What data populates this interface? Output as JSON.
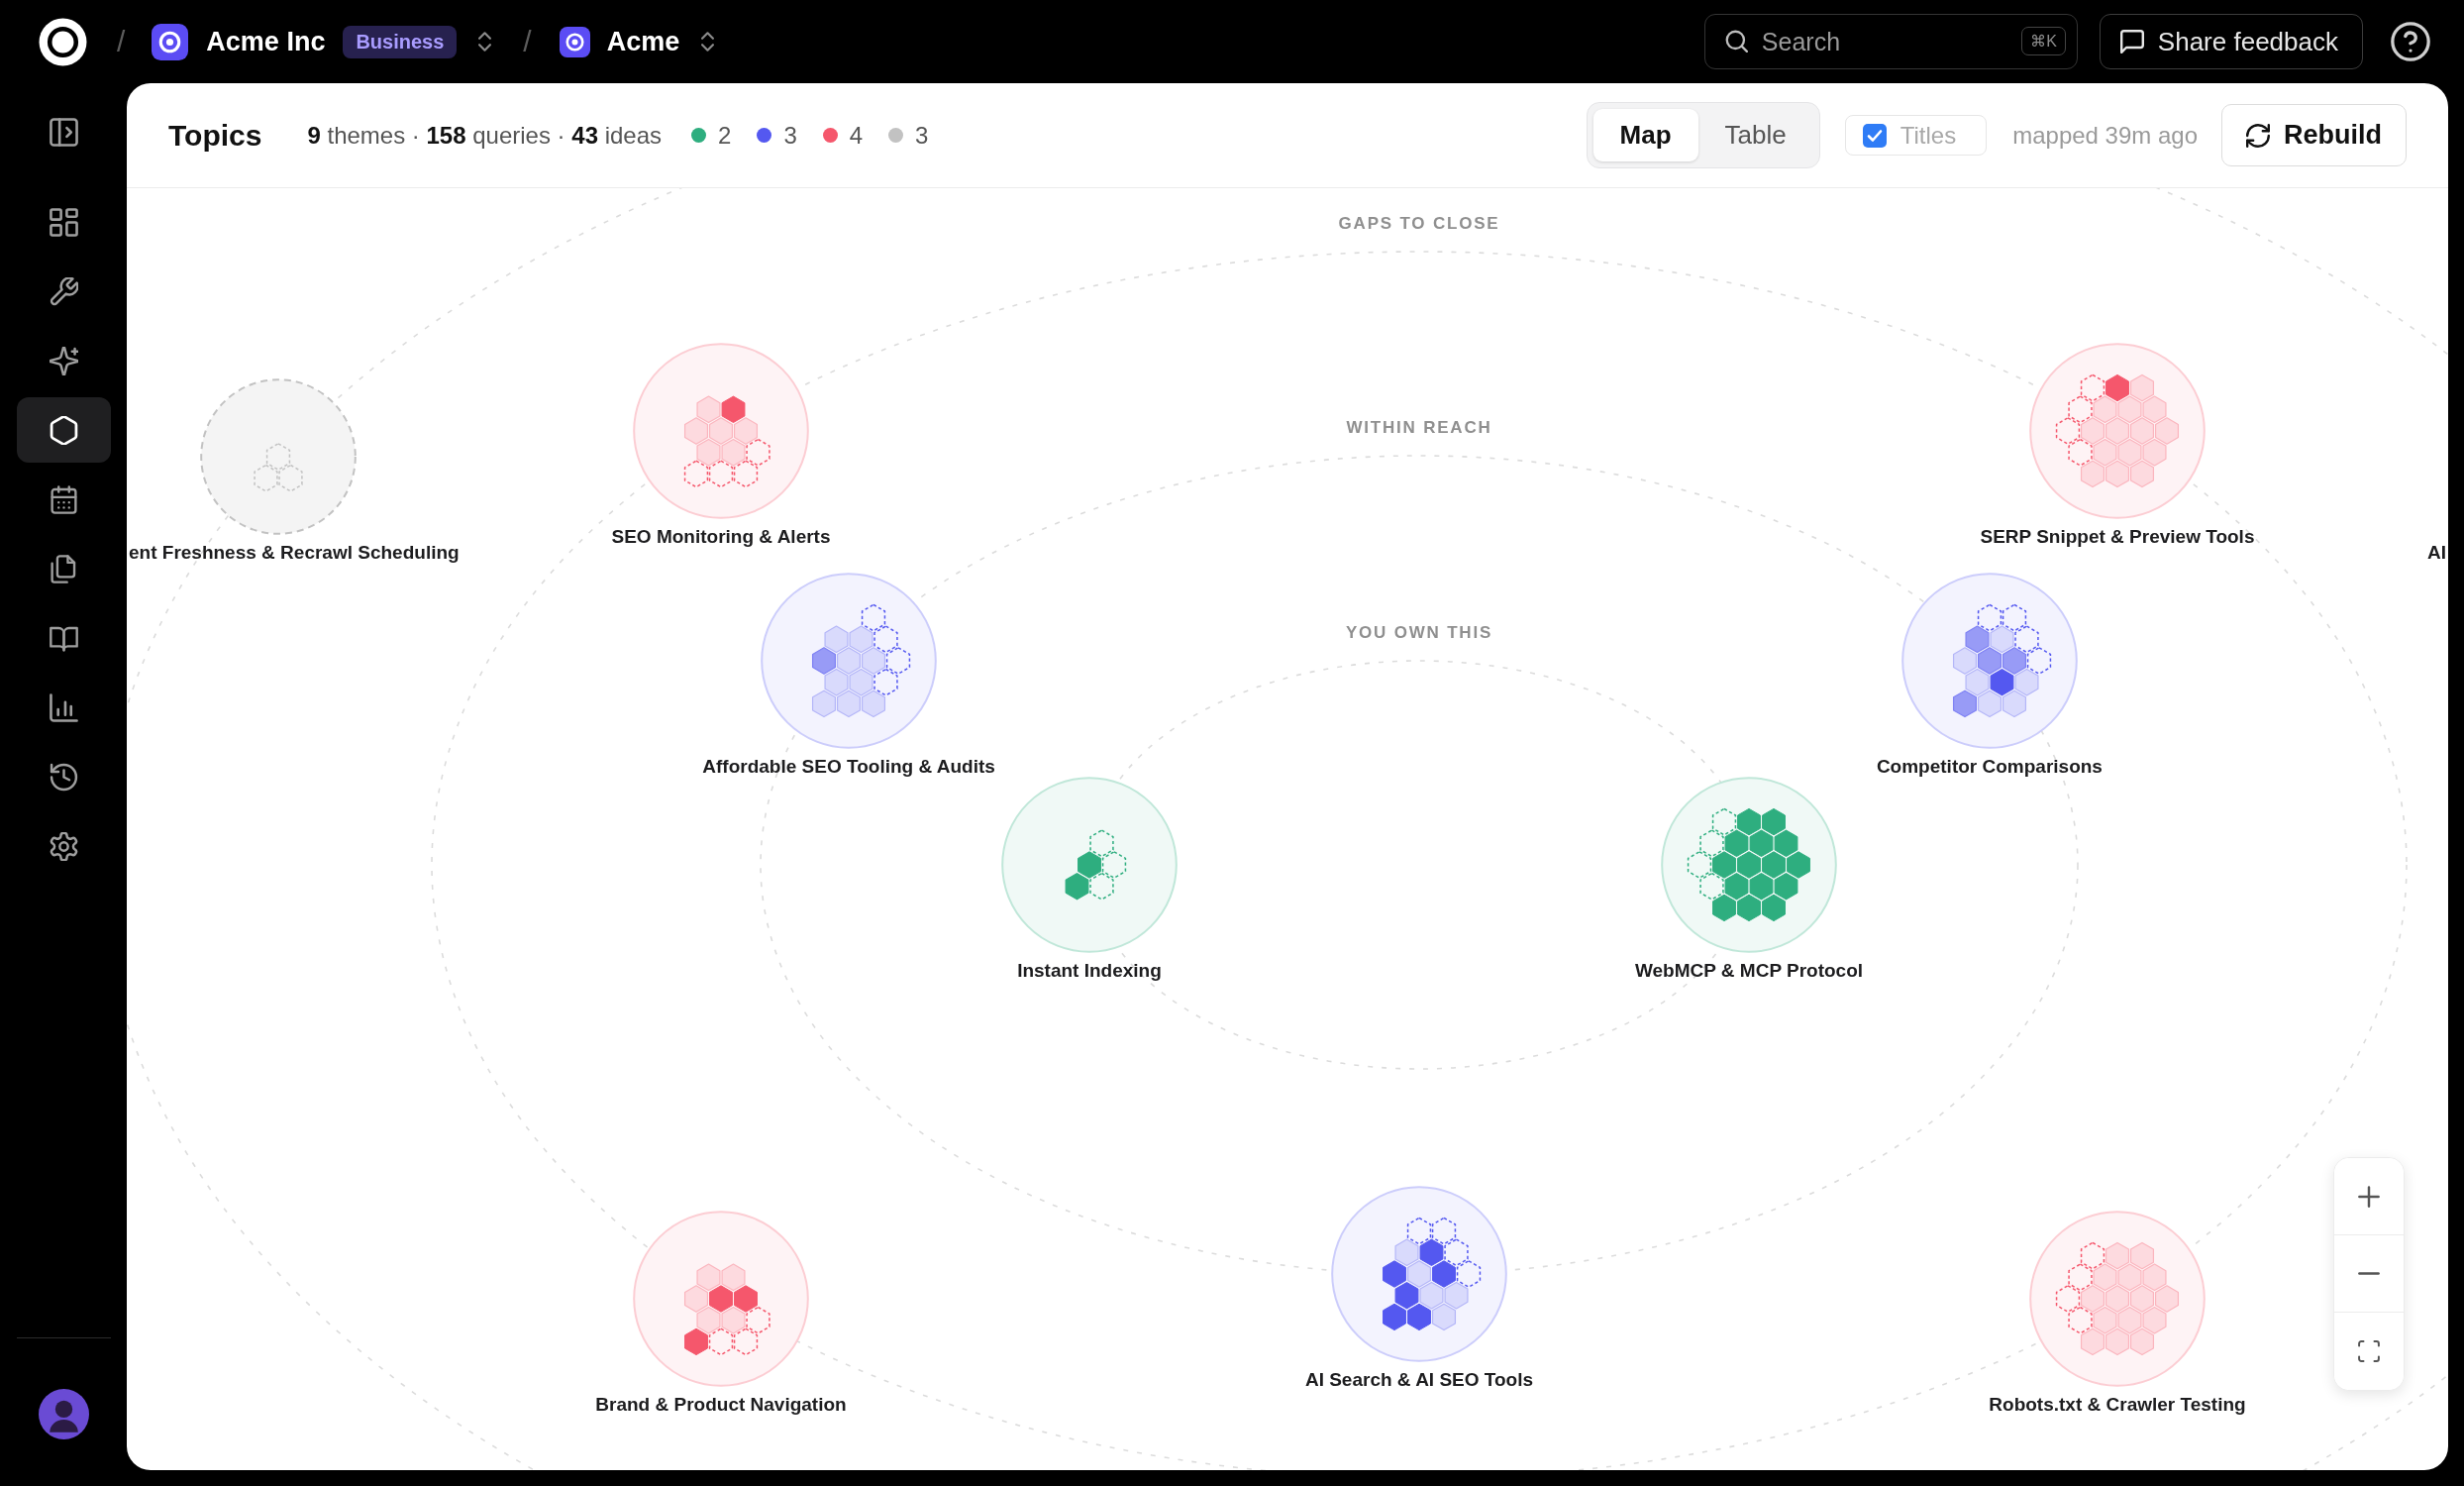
{
  "top_bar": {
    "separators": [
      "/",
      "/"
    ],
    "organization": {
      "name": "Acme Inc",
      "badge": "Business"
    },
    "project": {
      "name": "Acme"
    },
    "search": {
      "placeholder": "Search",
      "shortcut": "⌘K"
    },
    "feedback_button": {
      "label": "Share feedback"
    }
  },
  "sidebar": {
    "items": [
      {
        "kind": "dashboard",
        "selected": false
      },
      {
        "kind": "tools",
        "selected": false
      },
      {
        "kind": "sparkles",
        "selected": false
      },
      {
        "kind": "topics",
        "selected": true
      },
      {
        "kind": "calendar",
        "selected": false
      },
      {
        "kind": "pages",
        "selected": false
      },
      {
        "kind": "book",
        "selected": false
      },
      {
        "kind": "chart",
        "selected": false
      },
      {
        "kind": "history",
        "selected": false
      },
      {
        "kind": "settings",
        "selected": false
      }
    ]
  },
  "header": {
    "title": "Topics",
    "summary": "**9** themes · **158** queries · **43** ideas",
    "legend": [
      {
        "color": "#2eae7f",
        "count": "2"
      },
      {
        "color": "#5458f0",
        "count": "3"
      },
      {
        "color": "#f5576c",
        "count": "4"
      },
      {
        "color": "#c2c2c2",
        "count": "3"
      }
    ],
    "views": [
      {
        "label": "Map",
        "selected": true
      },
      {
        "label": "Table",
        "selected": false
      }
    ],
    "titles_toggle": {
      "label": "Titles",
      "checked": true
    },
    "status": "mapped 39m ago",
    "rebuild_button": {
      "label": "Rebuild"
    }
  },
  "map": {
    "rings": [
      {
        "label": "GAPS TO CLOSE",
        "color": "#f5576c",
        "nodes": [
          {
            "label": "SEO Monitoring & Alerts",
            "cells": [
              [
                null,
                null,
                null
              ],
              [
                null,
                {
                  "kind": "weak"
                },
                {
                  "kind": "strong"
                },
                null
              ],
              [
                null,
                {
                  "kind": "weak"
                },
                {
                  "kind": "weak"
                },
                {
                  "kind": "weak"
                },
                null
              ],
              [
                null,
                {
                  "kind": "weak"
                },
                {
                  "kind": "weak"
                },
                {
                  "kind": "gap"
                }
              ],
              [
                {
                  "kind": "gap"
                },
                {
                  "kind": "gap"
                },
                {
                  "kind": "gap"
                }
              ]
            ]
          },
          {
            "label": "SERP Snippet & Preview Tools",
            "cells": [
              [
                {
                  "kind": "gap"
                },
                {
                  "kind": "strong"
                },
                {
                  "kind": "weak"
                }
              ],
              [
                {
                  "kind": "gap"
                },
                {
                  "kind": "weak"
                },
                {
                  "kind": "weak"
                },
                {
                  "kind": "weak"
                }
              ],
              [
                {
                  "kind": "gap"
                },
                {
                  "kind": "weak"
                },
                {
                  "kind": "weak"
                },
                {
                  "kind": "weak"
                },
                {
                  "kind": "weak"
                }
              ],
              [
                {
                  "kind": "gap"
                },
                {
                  "kind": "weak"
                },
                {
                  "kind": "weak"
                },
                {
                  "kind": "weak"
                }
              ],
              [
                {
                  "kind": "weak"
                },
                {
                  "kind": "weak"
                },
                {
                  "kind": "weak"
                }
              ]
            ]
          },
          {
            "label": "Brand & Product Navigation",
            "cells": [
              [
                null,
                null,
                null
              ],
              [
                null,
                {
                  "kind": "weak"
                },
                {
                  "kind": "weak"
                },
                null
              ],
              [
                null,
                {
                  "kind": "weak"
                },
                {
                  "kind": "strong"
                },
                {
                  "kind": "strong"
                },
                null
              ],
              [
                null,
                {
                  "kind": "weak"
                },
                {
                  "kind": "weak"
                },
                {
                  "kind": "gap"
                }
              ],
              [
                {
                  "kind": "strong"
                },
                {
                  "kind": "gap"
                },
                {
                  "kind": "gap"
                }
              ]
            ]
          },
          {
            "label": "Robots.txt & Crawler Testing",
            "cells": [
              [
                {
                  "kind": "gap"
                },
                {
                  "kind": "weak"
                },
                {
                  "kind": "weak"
                }
              ],
              [
                {
                  "kind": "gap"
                },
                {
                  "kind": "weak"
                },
                {
                  "kind": "weak"
                },
                {
                  "kind": "weak"
                }
              ],
              [
                {
                  "kind": "gap"
                },
                {
                  "kind": "weak"
                },
                {
                  "kind": "weak"
                },
                {
                  "kind": "weak"
                },
                {
                  "kind": "weak"
                }
              ],
              [
                {
                  "kind": "gap"
                },
                {
                  "kind": "weak"
                },
                {
                  "kind": "weak"
                },
                {
                  "kind": "weak"
                }
              ],
              [
                {
                  "kind": "weak"
                },
                {
                  "kind": "weak"
                },
                {
                  "kind": "weak"
                }
              ]
            ]
          }
        ]
      },
      {
        "label": "WITHIN REACH",
        "color": "#5458f0",
        "nodes": [
          {
            "label": "Affordable SEO Tooling & Audits",
            "cells": [
              [
                null,
                null,
                {
                  "kind": "gap"
                }
              ],
              [
                null,
                {
                  "kind": "weak"
                },
                {
                  "kind": "weak"
                },
                {
                  "kind": "gap"
                }
              ],
              [
                null,
                {
                  "kind": "medium"
                },
                {
                  "kind": "weak"
                },
                {
                  "kind": "weak"
                },
                {
                  "kind": "gap"
                }
              ],
              [
                null,
                {
                  "kind": "weak"
                },
                {
                  "kind": "weak"
                },
                {
                  "kind": "gap"
                }
              ],
              [
                {
                  "kind": "weak"
                },
                {
                  "kind": "weak"
                },
                {
                  "kind": "weak"
                }
              ]
            ]
          },
          {
            "label": "Competitor Comparisons",
            "cells": [
              [
                null,
                {
                  "kind": "gap"
                },
                {
                  "kind": "gap"
                }
              ],
              [
                null,
                {
                  "kind": "medium"
                },
                {
                  "kind": "weak"
                },
                {
                  "kind": "gap"
                }
              ],
              [
                null,
                {
                  "kind": "weak"
                },
                {
                  "kind": "medium"
                },
                {
                  "kind": "medium"
                },
                {
                  "kind": "gap"
                }
              ],
              [
                null,
                {
                  "kind": "weak"
                },
                {
                  "kind": "strong"
                },
                {
                  "kind": "weak"
                }
              ],
              [
                {
                  "kind": "medium"
                },
                {
                  "kind": "weak"
                },
                {
                  "kind": "weak"
                }
              ]
            ]
          },
          {
            "label": "AI Search & AI SEO Tools",
            "cells": [
              [
                null,
                {
                  "kind": "gap"
                },
                {
                  "kind": "gap"
                }
              ],
              [
                null,
                {
                  "kind": "weak"
                },
                {
                  "kind": "strong"
                },
                {
                  "kind": "gap"
                }
              ],
              [
                null,
                {
                  "kind": "strong"
                },
                {
                  "kind": "weak"
                },
                {
                  "kind": "strong"
                },
                {
                  "kind": "gap"
                }
              ],
              [
                null,
                {
                  "kind": "strong"
                },
                {
                  "kind": "weak"
                },
                {
                  "kind": "weak"
                }
              ],
              [
                {
                  "kind": "strong"
                },
                {
                  "kind": "strong"
                },
                {
                  "kind": "weak"
                }
              ]
            ]
          }
        ]
      },
      {
        "label": "YOU OWN THIS",
        "color": "#2eae7f",
        "nodes": [
          {
            "label": "Instant Indexing",
            "cells": [
              [
                null,
                null,
                null
              ],
              [
                null,
                null,
                {
                  "kind": "gap"
                },
                null
              ],
              [
                null,
                null,
                {
                  "kind": "strong"
                },
                {
                  "kind": "gap"
                },
                null
              ],
              [
                null,
                {
                  "kind": "strong"
                },
                {
                  "kind": "gap"
                },
                null
              ],
              [
                null,
                null,
                null
              ]
            ]
          },
          {
            "label": "WebMCP & MCP Protocol",
            "cells": [
              [
                {
                  "kind": "gap"
                },
                {
                  "kind": "strong"
                },
                {
                  "kind": "strong"
                }
              ],
              [
                {
                  "kind": "gap"
                },
                {
                  "kind": "strong"
                },
                {
                  "kind": "strong"
                },
                {
                  "kind": "strong"
                }
              ],
              [
                {
                  "kind": "gap"
                },
                {
                  "kind": "strong"
                },
                {
                  "kind": "strong"
                },
                {
                  "kind": "strong"
                },
                {
                  "kind": "strong"
                }
              ],
              [
                {
                  "kind": "gap"
                },
                {
                  "kind": "strong"
                },
                {
                  "kind": "strong"
                },
                {
                  "kind": "strong"
                }
              ],
              [
                {
                  "kind": "strong"
                },
                {
                  "kind": "strong"
                },
                {
                  "kind": "strong"
                }
              ]
            ]
          }
        ]
      },
      {
        "color": "#c2c2c2",
        "nodes": [
          {
            "label": "ent Freshness & Recrawl Scheduling",
            "cells": [
              [
                null,
                null,
                null
              ],
              [
                null,
                null,
                null,
                null
              ],
              [
                null,
                null,
                {
                  "kind": "gap"
                },
                null,
                null
              ],
              [
                null,
                {
                  "kind": "gap"
                },
                {
                  "kind": "gap"
                },
                null
              ],
              [
                null,
                null,
                null
              ]
            ]
          },
          {
            "label": "AI"
          }
        ]
      }
    ]
  }
}
